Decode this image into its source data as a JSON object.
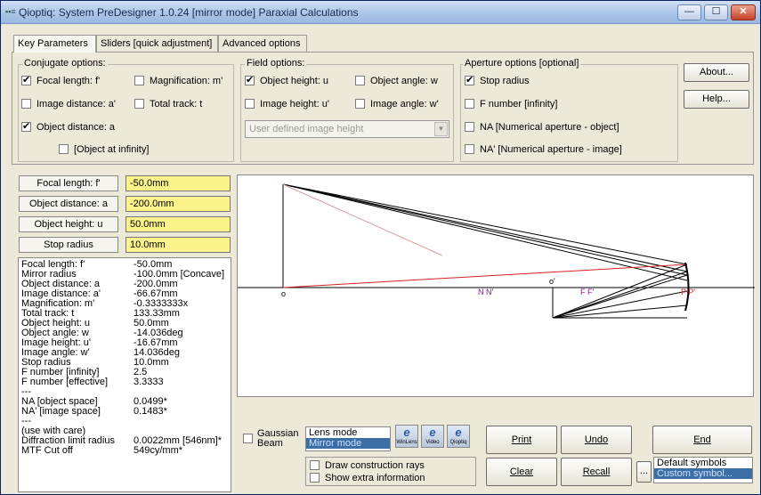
{
  "window": {
    "title": "Qioptiq: System PreDesigner 1.0.24   [mirror mode]  Paraxial Calculations",
    "icon_text": "▪▪≡",
    "min_label": "—",
    "max_label": "☐",
    "close_label": "✕"
  },
  "tabs": [
    {
      "label": "Key Parameters"
    },
    {
      "label": "Sliders [quick adjustment]"
    },
    {
      "label": "Advanced options"
    }
  ],
  "conjugate": {
    "title": "Conjugate options:",
    "items": [
      {
        "label": "Focal length: f'",
        "checked": true
      },
      {
        "label": "Magnification: m'",
        "checked": false
      },
      {
        "label": "Image distance: a'",
        "checked": false
      },
      {
        "label": "Total track: t",
        "checked": false
      },
      {
        "label": "Object distance: a",
        "checked": true
      },
      {
        "label": "[Object at infinity]",
        "checked": false
      }
    ]
  },
  "field": {
    "title": "Field options:",
    "items": [
      {
        "label": "Object height: u",
        "checked": true
      },
      {
        "label": "Object angle: w",
        "checked": false
      },
      {
        "label": "Image height: u'",
        "checked": false
      },
      {
        "label": "Image angle: w'",
        "checked": false
      }
    ],
    "combo_value": "User defined image height"
  },
  "aperture": {
    "title": "Aperture options [optional]",
    "items": [
      {
        "label": "Stop radius",
        "checked": true
      },
      {
        "label": "F number [infinity]",
        "checked": false
      },
      {
        "label": "NA [Numerical aperture - object]",
        "checked": false
      },
      {
        "label": "NA' [Numerical aperture - image]",
        "checked": false
      }
    ]
  },
  "buttons": {
    "about": "About...",
    "help": "Help...",
    "print": "Print",
    "undo": "Undo",
    "end": "End",
    "clear": "Clear",
    "recall": "Recall",
    "ellipsis": "..."
  },
  "params": [
    {
      "label": "Focal length: f'",
      "value": "-50.0mm"
    },
    {
      "label": "Object distance: a",
      "value": "-200.0mm"
    },
    {
      "label": "Object height: u",
      "value": "50.0mm"
    },
    {
      "label": "Stop radius",
      "value": "10.0mm"
    }
  ],
  "results": [
    {
      "k": "Focal length: f'",
      "v": "-50.0mm"
    },
    {
      "k": "Mirror radius",
      "v": "-100.0mm   [Concave]"
    },
    {
      "k": "Object distance: a",
      "v": "-200.0mm"
    },
    {
      "k": "Image distance: a'",
      "v": "-66.67mm"
    },
    {
      "k": "Magnification: m'",
      "v": "-0.3333333x"
    },
    {
      "k": "Total track: t",
      "v": "133.33mm"
    },
    {
      "k": "Object height: u",
      "v": "50.0mm"
    },
    {
      "k": "Object angle: w",
      "v": "-14.036deg"
    },
    {
      "k": "Image height: u'",
      "v": "-16.67mm"
    },
    {
      "k": "Image angle: w'",
      "v": "14.036deg"
    },
    {
      "k": "Stop radius",
      "v": "10.0mm"
    },
    {
      "k": "F number [infinity]",
      "v": "2.5"
    },
    {
      "k": "F number [effective]",
      "v": "3.3333"
    },
    {
      "k": "  ---",
      "v": ""
    },
    {
      "k": "NA [object space]",
      "v": "0.0499*"
    },
    {
      "k": "NA' [image space]",
      "v": "0.1483*"
    },
    {
      "k": "  ---",
      "v": ""
    },
    {
      "k": "  (use with care)",
      "v": ""
    },
    {
      "k": "Diffraction limit radius",
      "v": "0.0022mm [546nm]*"
    },
    {
      "k": "MTF Cut off",
      "v": "549cy/mm*"
    }
  ],
  "diagram": {
    "label_o": "o",
    "label_nn": "N N'",
    "label_oprime": "o'",
    "label_ff": "F F'",
    "label_pp": "P P'"
  },
  "options": {
    "gaussian": "Gaussian Beam",
    "gaussian_checked": false,
    "modes": [
      "Lens mode",
      "Mirror mode"
    ],
    "selected_mode": 1,
    "construction_rays": "Draw construction rays",
    "extra_info": "Show extra information",
    "symbols": [
      "Default symbols",
      "Custom symbol..."
    ],
    "selected_symbol": 1
  },
  "icon_buttons": [
    {
      "label": "WinLens"
    },
    {
      "label": "Video"
    },
    {
      "label": "Qioptiq"
    }
  ],
  "colors": {
    "highlight_value": "#fbf28a",
    "axis_red": "#d42020",
    "label_purple": "#8a1a8a",
    "selection_blue": "#3a6ea5"
  }
}
